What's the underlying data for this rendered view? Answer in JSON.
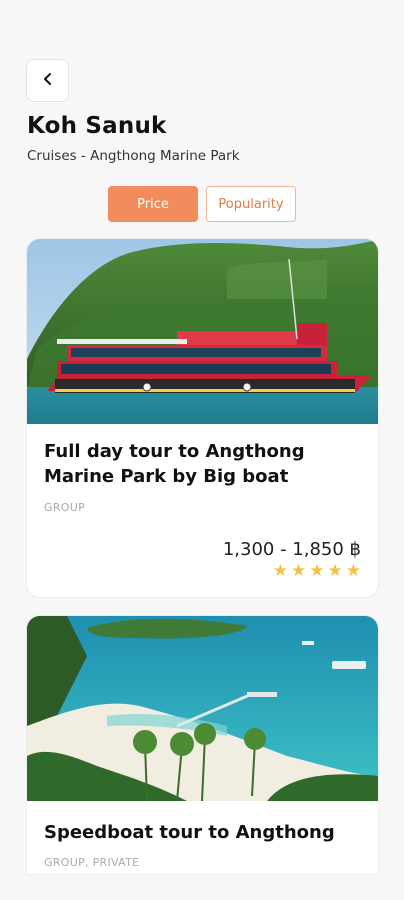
{
  "header": {
    "back_icon": "chevron-left-icon",
    "title": "Koh Sanuk",
    "subtitle": "Cruises - Angthong Marine Park"
  },
  "sort": {
    "tabs": [
      {
        "label": "Price",
        "active": true
      },
      {
        "label": "Popularity",
        "active": false
      }
    ],
    "accent": "#f28c5c"
  },
  "tours": [
    {
      "title": "Full day tour to Angthong Marine Park by Big boat",
      "tag": "GROUP",
      "price": "1,300 - 1,850 ฿",
      "rating": 5,
      "stars": [
        "★",
        "★",
        "★",
        "★",
        "★"
      ]
    },
    {
      "title": "Speedboat tour to Angthong",
      "tag": "GROUP, PRIVATE"
    }
  ]
}
